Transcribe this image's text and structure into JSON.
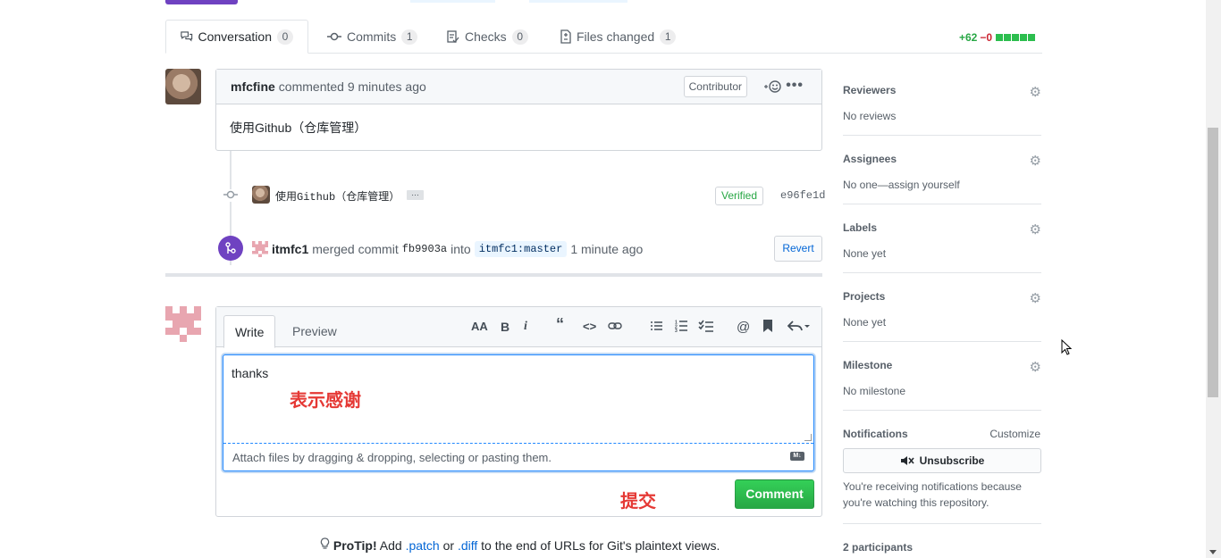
{
  "tabs": [
    {
      "label": "Conversation",
      "count": "0",
      "icon": "comment-discussion-icon"
    },
    {
      "label": "Commits",
      "count": "1",
      "icon": "git-commit-icon"
    },
    {
      "label": "Checks",
      "count": "0",
      "icon": "checklist-icon"
    },
    {
      "label": "Files changed",
      "count": "1",
      "icon": "file-diff-icon"
    }
  ],
  "diffstat": {
    "added": "+62",
    "removed": "−0"
  },
  "comment": {
    "author": "mfcfine",
    "action": "commented",
    "time": "9 minutes ago",
    "badge": "Contributor",
    "reaction": "+☺",
    "menu": "•••",
    "body": "使用Github（仓库管理）"
  },
  "commit": {
    "message": "使用Github（仓库管理）",
    "ellipsis": "…",
    "verified": "Verified",
    "sha": "e96fe1d"
  },
  "merge": {
    "author": "itmfc1",
    "text1": "merged commit",
    "sha": "fb9903a",
    "text2": "into",
    "branch": "itmfc1:master",
    "time": "1 minute ago",
    "revert_label": "Revert"
  },
  "editor": {
    "write_tab": "Write",
    "preview_tab": "Preview",
    "value": "thanks",
    "attach_hint": "Attach files by dragging & dropping, selecting or pasting them.",
    "submit_label": "Comment",
    "annotation_text": "表示感谢",
    "annotation_submit": "提交"
  },
  "protip": {
    "label": "ProTip!",
    "t1": "Add",
    "patch": ".patch",
    "t2": "or",
    "diff": ".diff",
    "t3": "to the end of URLs for Git's plaintext views."
  },
  "sidebar": {
    "reviewers": {
      "title": "Reviewers",
      "value": "No reviews"
    },
    "assignees": {
      "title": "Assignees",
      "value": "No one—assign yourself"
    },
    "labels": {
      "title": "Labels",
      "value": "None yet"
    },
    "projects": {
      "title": "Projects",
      "value": "None yet"
    },
    "milestone": {
      "title": "Milestone",
      "value": "No milestone"
    },
    "notifications": {
      "title": "Notifications",
      "customize": "Customize",
      "button": "Unsubscribe",
      "note": "You're receiving notifications because you're watching this repository."
    },
    "participants": "2 participants"
  },
  "colors": {
    "accent": "#0366d6",
    "merged": "#6f42c1",
    "success": "#28a745"
  }
}
